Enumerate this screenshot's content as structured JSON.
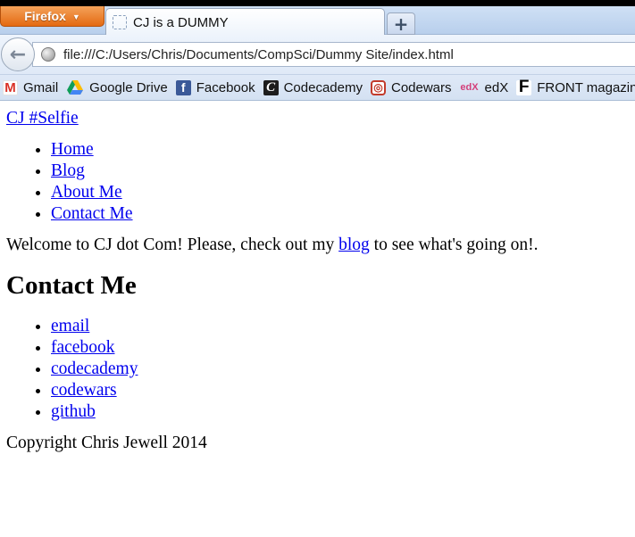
{
  "browser": {
    "menu_label": "Firefox",
    "menu_caret": "▼",
    "tab_title": "CJ is a DUMMY",
    "new_tab_label": "+",
    "back_label": "←",
    "url": "file:///C:/Users/Chris/Documents/CompSci/Dummy Site/index.html",
    "bookmarks": [
      {
        "label": "Gmail",
        "icon": "gmail-icon",
        "glyph": "M"
      },
      {
        "label": "Google Drive",
        "icon": "google-drive-icon",
        "glyph": ""
      },
      {
        "label": "Facebook",
        "icon": "facebook-icon",
        "glyph": "f"
      },
      {
        "label": "Codecademy",
        "icon": "codecademy-icon",
        "glyph": "C"
      },
      {
        "label": "Codewars",
        "icon": "codewars-icon",
        "glyph": "◎"
      },
      {
        "label": "edX",
        "icon": "edx-icon",
        "glyph": "edX"
      },
      {
        "label": "FRONT magazine",
        "icon": "front-magazine-icon",
        "glyph": "F"
      }
    ]
  },
  "page": {
    "site_title": "CJ #Selfie",
    "nav": [
      "Home",
      "Blog",
      "About Me",
      "Contact Me"
    ],
    "welcome_before": "Welcome to CJ dot Com! Please, check out my ",
    "welcome_link": "blog",
    "welcome_after": " to see what's going on!.",
    "contact_heading": "Contact Me",
    "contact_links": [
      "email",
      "facebook",
      "codecademy",
      "codewars",
      "github"
    ],
    "footer": "Copyright Chris Jewell 2014"
  },
  "colors": {
    "link": "#0000ee",
    "firefox_orange": "#e46a12"
  }
}
